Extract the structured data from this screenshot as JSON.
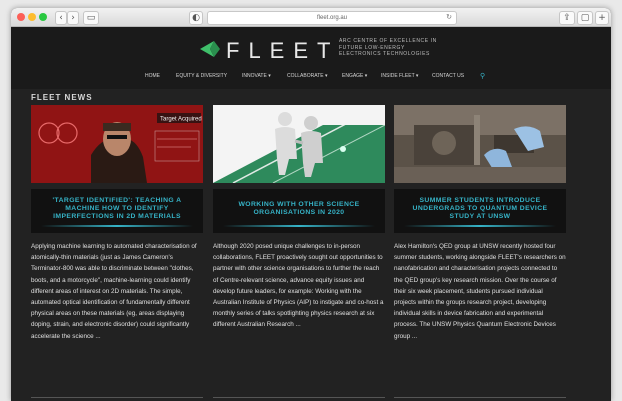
{
  "browser": {
    "url": "fleet.org.au"
  },
  "header": {
    "logo_text": "FLEET",
    "tagline_lines": [
      "ARC CENTRE OF EXCELLENCE IN",
      "FUTURE LOW-ENERGY",
      "ELECTRONICS TECHNOLOGIES"
    ],
    "accent": "#36b3c7",
    "logo_green": "#3fbf6a"
  },
  "nav": {
    "items": [
      "HOME",
      "EQUITY & DIVERSITY",
      "INNOVATE ▾",
      "COLLABORATE ▾",
      "ENGAGE ▾",
      "INSIDE FLEET ▾",
      "CONTACT US"
    ],
    "search_icon": "search-icon"
  },
  "section": {
    "title": "FLEET NEWS"
  },
  "cards": [
    {
      "image_caption": "Target Acquired",
      "title_lines": [
        "'TARGET IDENTIFIED': TEACHING A",
        "MACHINE HOW TO IDENTIFY",
        "IMPERFECTIONS IN 2D MATERIALS"
      ],
      "excerpt": "Applying machine learning to automated characterisation of atomically-thin materials (just as James Cameron's Terminator-800 was able to discriminate between \"clothes, boots, and a motorcycle\", machine-learning could identify different areas of interest on 2D materials. The simple, automated optical identification of fundamentally different physical areas on these materials (eg, areas displaying doping, strain, and electronic disorder) could significantly accelerate the science ..."
    },
    {
      "title_lines": [
        "WORKING WITH OTHER SCIENCE",
        "ORGANISATIONS IN 2020"
      ],
      "excerpt": "Although 2020 posed unique challenges to in-person collaborations, FLEET proactively sought out opportunities to partner with other science organisations to further the reach of Centre-relevant science, advance equity issues and develop future leaders, for example: Working with the Australian Institute of Physics (AIP) to instigate and co-host a monthly series of talks spotlighting physics research at six different Australian Research ..."
    },
    {
      "title_lines": [
        "SUMMER STUDENTS INTRODUCE",
        "UNDERGRADS TO QUANTUM DEVICE",
        "STUDY AT UNSW"
      ],
      "excerpt": "Alex Hamilton's QED group at UNSW recently hosted four summer students, working alongside FLEET's researchers on nanofabrication and characterisation projects connected to the QED group's key research mission. Over the course of their six week placement, students pursued individual projects within the groups research project, developing individual skills in device fabrication and experimental process. The UNSW Physics Quantum Electronic Devices group ..."
    }
  ]
}
